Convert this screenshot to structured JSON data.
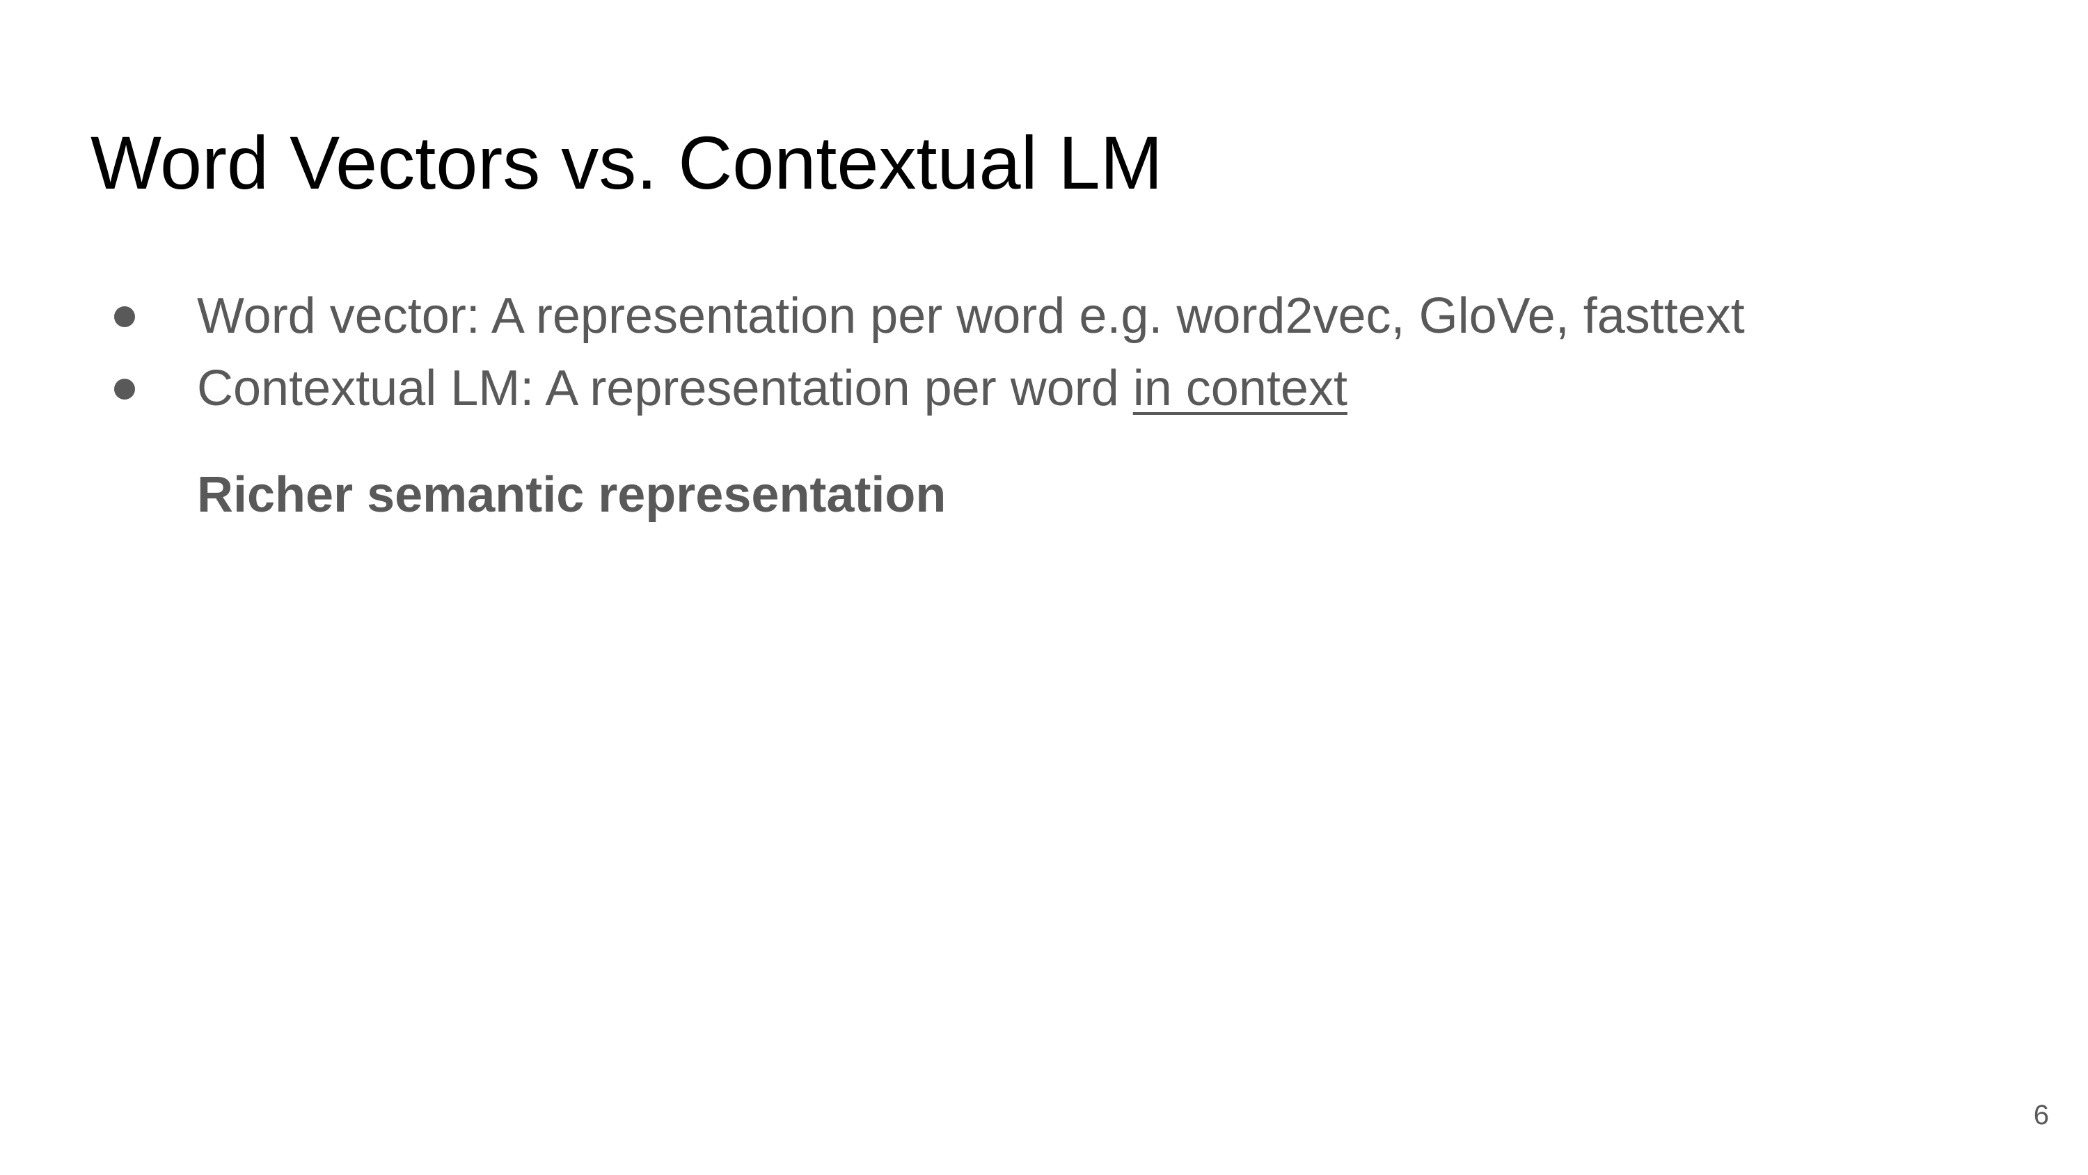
{
  "slide": {
    "title": "Word Vectors vs. Contextual LM",
    "bullets": [
      {
        "text": "Word vector: A representation per word e.g. word2vec, GloVe, fasttext"
      },
      {
        "text_plain": "Contextual LM: A representation per word ",
        "text_underlined": "in context"
      }
    ],
    "emphasis": "Richer semantic representation",
    "page_number": "6"
  },
  "colors": {
    "title": "#000000",
    "body_text": "#595959",
    "background": "#ffffff"
  }
}
